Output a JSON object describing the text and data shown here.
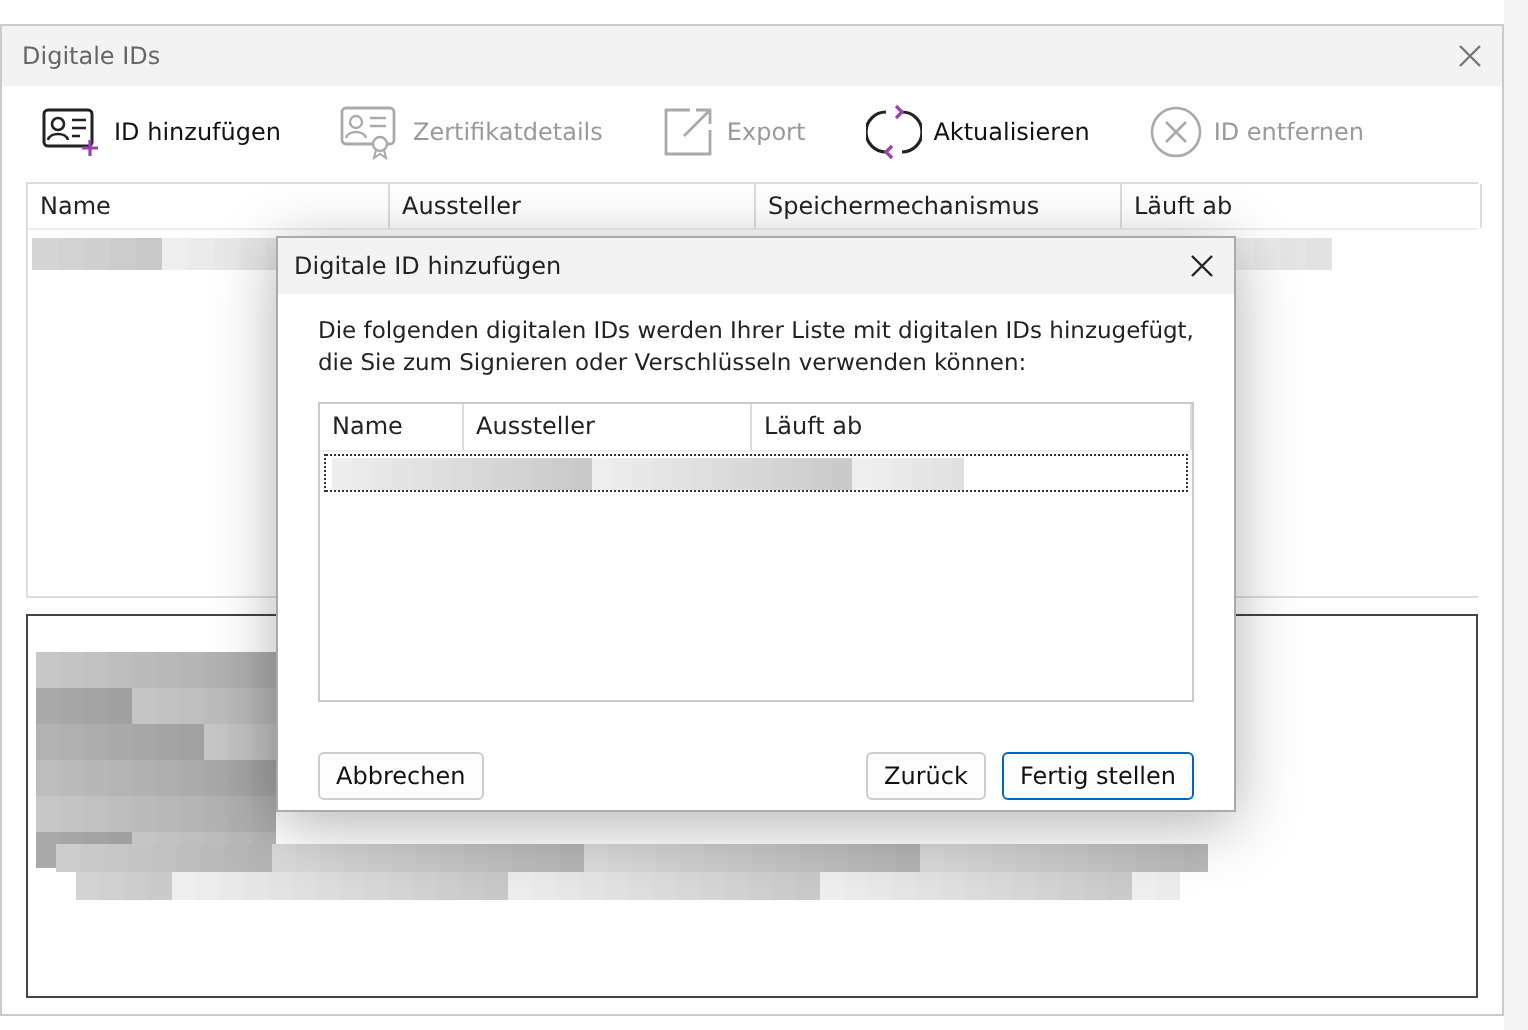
{
  "window": {
    "title": "Digitale IDs"
  },
  "toolbar": [
    {
      "label": "ID hinzufügen",
      "kind": "card-plus",
      "disabled": false
    },
    {
      "label": "Zertifikatdetails",
      "kind": "certificate",
      "disabled": true
    },
    {
      "label": "Export",
      "kind": "export",
      "disabled": true
    },
    {
      "label": "Aktualisieren",
      "kind": "refresh",
      "disabled": false
    },
    {
      "label": "ID entfernen",
      "kind": "remove",
      "disabled": true
    }
  ],
  "table": {
    "columns": [
      "Name",
      "Aussteller",
      "Speichermechanismus",
      "Läuft ab"
    ]
  },
  "dialog": {
    "title": "Digitale ID hinzufügen",
    "message": "Die folgenden digitalen IDs werden Ihrer Liste mit digitalen IDs hinzugefügt, die Sie zum Signieren oder Verschlüsseln verwenden können:",
    "table": {
      "columns": [
        "Name",
        "Aussteller",
        "Läuft ab"
      ]
    },
    "buttons": [
      {
        "label": "Abbrechen",
        "default": false
      },
      {
        "label": "Zurück",
        "default": false
      },
      {
        "label": "Fertig stellen",
        "default": true
      }
    ]
  }
}
